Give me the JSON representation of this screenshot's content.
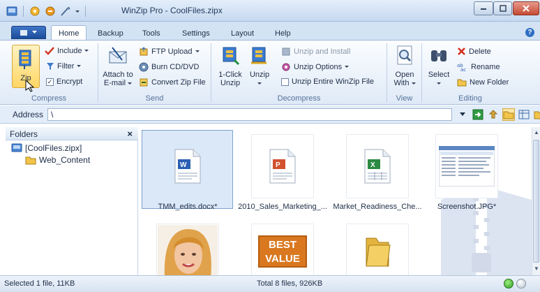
{
  "window": {
    "title": "WinZip Pro - CoolFiles.zipx"
  },
  "tabs": [
    {
      "label": "Home",
      "active": true
    },
    {
      "label": "Backup"
    },
    {
      "label": "Tools"
    },
    {
      "label": "Settings"
    },
    {
      "label": "Layout"
    },
    {
      "label": "Help"
    }
  ],
  "ribbon": {
    "compress": {
      "label": "Compress",
      "zip": "Zip",
      "include": "Include",
      "filter": "Filter",
      "encrypt": "Encrypt"
    },
    "send": {
      "label": "Send",
      "attach_line1": "Attach to",
      "attach_line2": "E-mail",
      "ftp": "FTP Upload",
      "burn": "Burn CD/DVD",
      "convert": "Convert Zip File"
    },
    "decompress": {
      "label": "Decompress",
      "oneclick_line1": "1-Click",
      "oneclick_line2": "Unzip",
      "unzip": "Unzip",
      "unzip_install": "Unzip and Install",
      "unzip_options": "Unzip Options",
      "unzip_entire": "Unzip Entire WinZip File"
    },
    "view": {
      "label": "View",
      "open_line1": "Open",
      "open_line2": "With"
    },
    "editing": {
      "label": "Editing",
      "select": "Select",
      "delete": "Delete",
      "rename": "Rename",
      "new_folder": "New Folder"
    }
  },
  "address": {
    "label": "Address",
    "value": "\\"
  },
  "folders": {
    "title": "Folders",
    "close": "×",
    "items": [
      {
        "label": "[CoolFiles.zipx]"
      },
      {
        "label": "Web_Content"
      }
    ]
  },
  "files": [
    {
      "name": "TMM_edits.docx*",
      "icon": "word-doc-icon"
    },
    {
      "name": "2010_Sales_Marketing_...",
      "icon": "powerpoint-doc-icon"
    },
    {
      "name": "Market_Readiness_Che...",
      "icon": "excel-doc-icon"
    },
    {
      "name": "Screenshot.JPG*",
      "icon": "screenshot-thumbnail"
    },
    {
      "name": "",
      "icon": "woman-photo-thumbnail"
    },
    {
      "name": "",
      "icon": "best-value-thumbnail",
      "badge_line1": "BEST",
      "badge_line2": "VALUE"
    },
    {
      "name": "",
      "icon": "folder-icon"
    }
  ],
  "status": {
    "left": "Selected 1 file, 11KB",
    "mid": "Total 8 files, 926KB"
  },
  "colors": {
    "accent": "#2f6fc3",
    "selection": "#dbe8f8"
  }
}
